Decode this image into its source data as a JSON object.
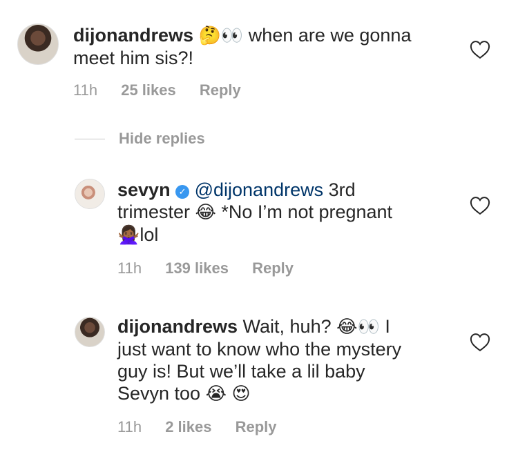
{
  "comments": [
    {
      "username": "dijonandrews",
      "emoji_1": "🤔",
      "emoji_2": "👀",
      "text_line1": " when are we gonna",
      "text_line2": "meet him sis?!",
      "time": "11h",
      "likes": "25 likes",
      "reply": "Reply"
    },
    {
      "username": "sevyn",
      "mention": "@dijonandrews",
      "text_part1": " 3rd",
      "text_line2a": "trimester ",
      "emoji_1": "😂",
      "text_line2b": " *No I’m not pregnant",
      "emoji_2": "🙅🏾‍♀️",
      "text_line3": "lol",
      "time": "11h",
      "likes": "139 likes",
      "reply": "Reply"
    },
    {
      "username": "dijonandrews",
      "text_part1": " Wait, huh? ",
      "emoji_1": "😂",
      "emoji_2": "👀",
      "text_part2": " I",
      "text_line2": "just want to know who the mystery",
      "text_line3": "guy is! But we’ll take a lil baby",
      "text_line4": "Sevyn too ",
      "emoji_3": "😭",
      "emoji_4": "😍",
      "time": "11h",
      "likes": "2 likes",
      "reply": "Reply"
    }
  ],
  "hide_replies": "Hide replies",
  "icons": {
    "heart": "heart-outline-icon",
    "verified": "verified-badge-icon"
  },
  "colors": {
    "text": "#262626",
    "meta": "#999999",
    "mention": "#003569",
    "verified": "#3897f0"
  }
}
